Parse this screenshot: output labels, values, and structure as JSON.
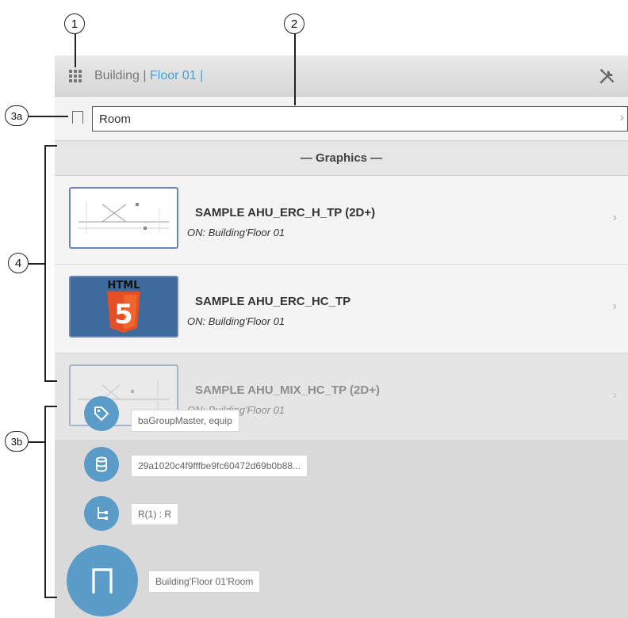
{
  "callouts": {
    "c1": "1",
    "c2": "2",
    "c3a": "3a",
    "c4": "4",
    "c3b": "3b"
  },
  "header": {
    "breadcrumb_root": "Building",
    "breadcrumb_sep": " | ",
    "breadcrumb_current": "Floor 01",
    "breadcrumb_trail": " |",
    "grid_icon": "grid-icon",
    "tools_icon": "tools-icon"
  },
  "selector": {
    "value": "Room",
    "chevron": "›"
  },
  "graphics": {
    "header": "— Graphics —",
    "items": [
      {
        "title": "SAMPLE AHU_ERC_H_TP (2D+)",
        "subtitle": "ON: Building'Floor 01",
        "chevron": "›",
        "thumb": "2d-schematic"
      },
      {
        "title": "SAMPLE AHU_ERC_HC_TP",
        "subtitle": "ON: Building'Floor 01",
        "chevron": "›",
        "thumb": "html5",
        "thumb_label": "HTML",
        "thumb_glyph": "5"
      },
      {
        "title": "SAMPLE AHU_MIX_HC_TP (2D+)",
        "subtitle": "ON: Building'Floor 01",
        "chevron": "›",
        "thumb": "2d-schematic"
      }
    ]
  },
  "fab_menu": {
    "tag": "baGroupMaster, equip",
    "id": "29a1020c4f9fffbe9fc60472d69b0b88...",
    "relation": "R(1) : R",
    "path": "Building'Floor 01'Room"
  },
  "colors": {
    "accent": "#3aa5dc",
    "fab": "#5b9bc8",
    "html5_orange": "#e34f26",
    "thumb_border": "#6a86b0"
  }
}
